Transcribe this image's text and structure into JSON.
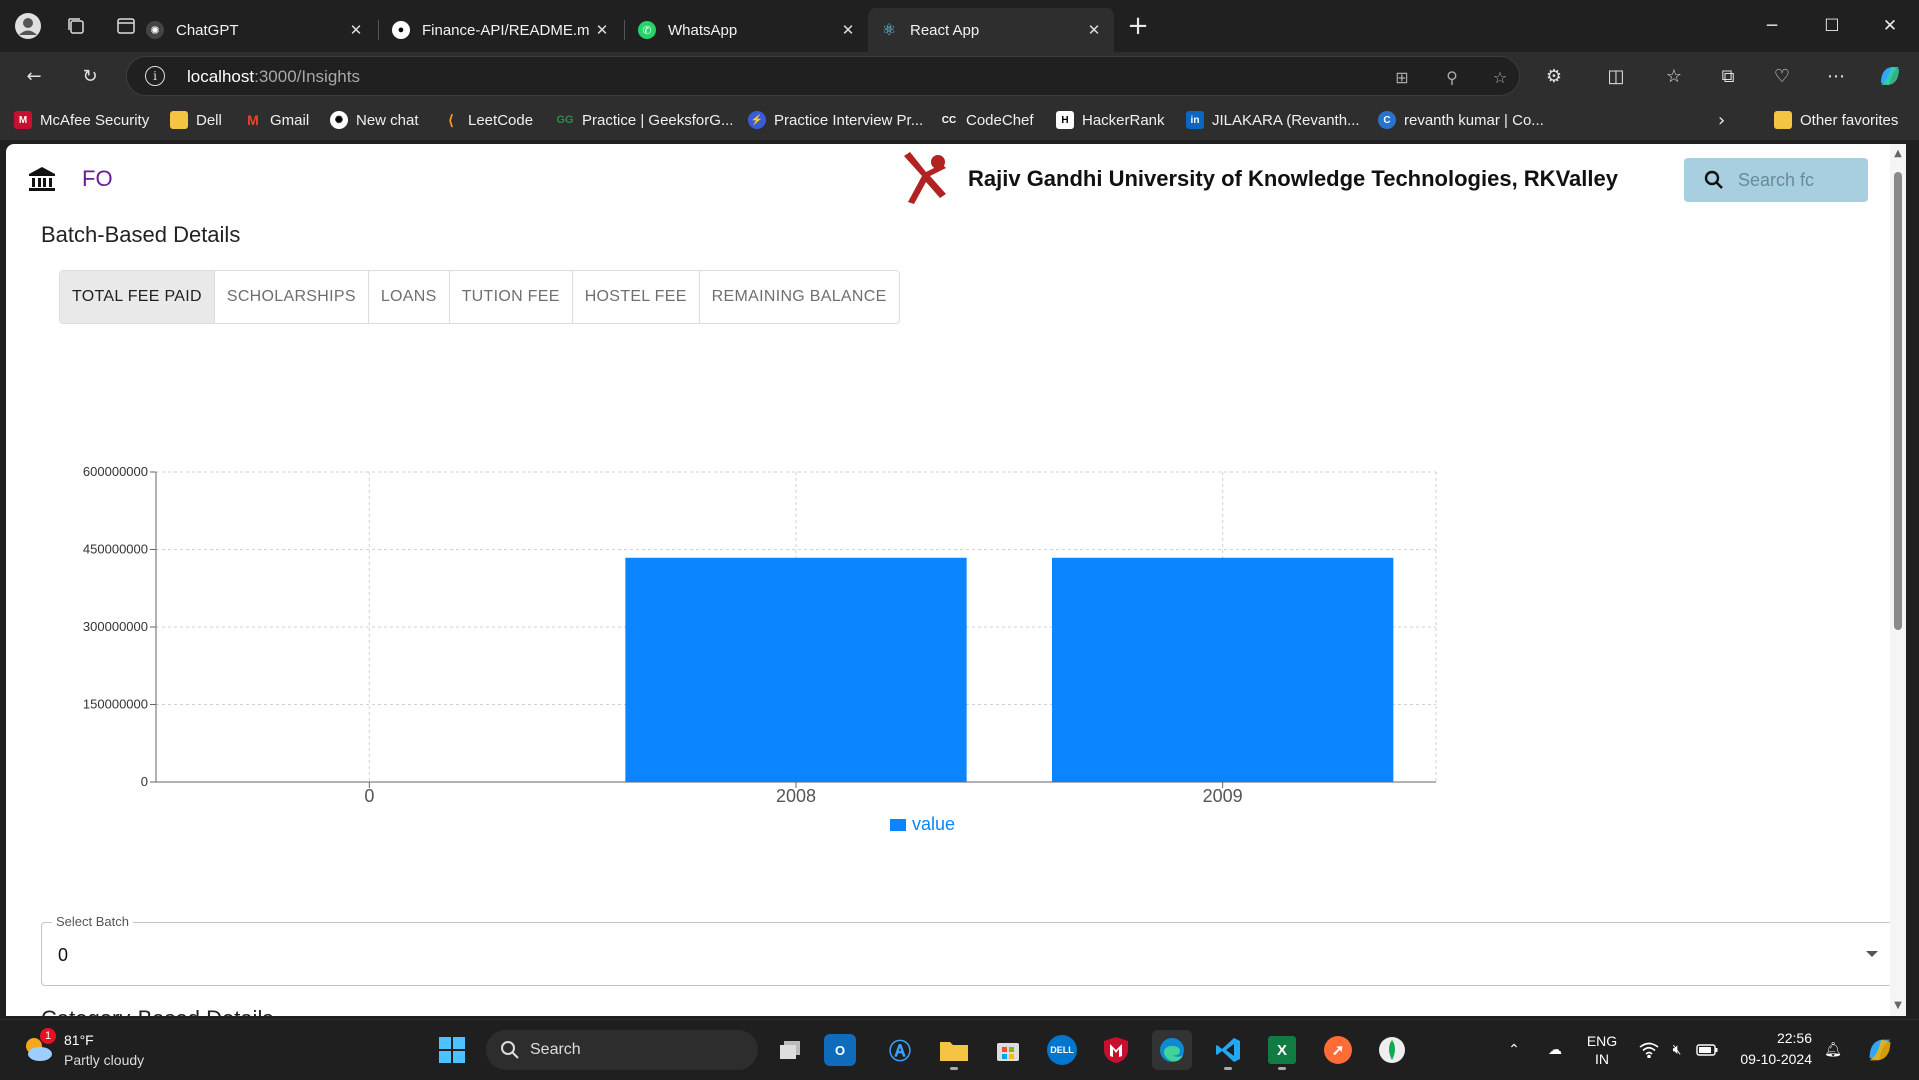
{
  "browser": {
    "tabs": [
      {
        "title": "ChatGPT",
        "active": false
      },
      {
        "title": "Finance-API/README.md at main",
        "active": false
      },
      {
        "title": "WhatsApp",
        "active": false
      },
      {
        "title": "React App",
        "active": true
      }
    ],
    "url_host": "localhost",
    "url_path": ":3000/Insights",
    "bookmarks": [
      "McAfee Security",
      "Dell",
      "Gmail",
      "New chat",
      "LeetCode",
      "Practice | GeeksforG...",
      "Practice Interview Pr...",
      "CodeChef",
      "HackerRank",
      "JILAKARA (Revanth...",
      "revanth kumar | Co..."
    ],
    "other_favorites": "Other favorites"
  },
  "app": {
    "brand": "FO",
    "university": "Rajiv Gandhi University of Knowledge Technologies, RKValley",
    "search_placeholder": "Search fc",
    "section_title": "Batch-Based Details",
    "tabs": [
      "TOTAL FEE PAID",
      "SCHOLARSHIPS",
      "LOANS",
      "TUTION FEE",
      "HOSTEL FEE",
      "REMAINING BALANCE"
    ],
    "selected_tab": "TOTAL FEE PAID",
    "select_batch_label": "Select Batch",
    "select_batch_value": "0",
    "next_section_title": "Category-Based Details"
  },
  "chart_data": {
    "type": "bar",
    "categories": [
      "0",
      "2008",
      "2009"
    ],
    "series": [
      {
        "name": "value",
        "values": [
          0,
          434000000,
          434000000
        ],
        "color": "#0a84ff"
      }
    ],
    "yticks": [
      "0",
      "150000000",
      "300000000",
      "450000000",
      "600000000"
    ],
    "ylim": [
      0,
      600000000
    ],
    "grid": true,
    "legend_position": "bottom-center"
  },
  "taskbar": {
    "weather_temp": "81°F",
    "weather_cond": "Partly cloudy",
    "weather_badge": "1",
    "search_label": "Search",
    "lang_top": "ENG",
    "lang_bottom": "IN",
    "time": "22:56",
    "date": "09-10-2024"
  }
}
